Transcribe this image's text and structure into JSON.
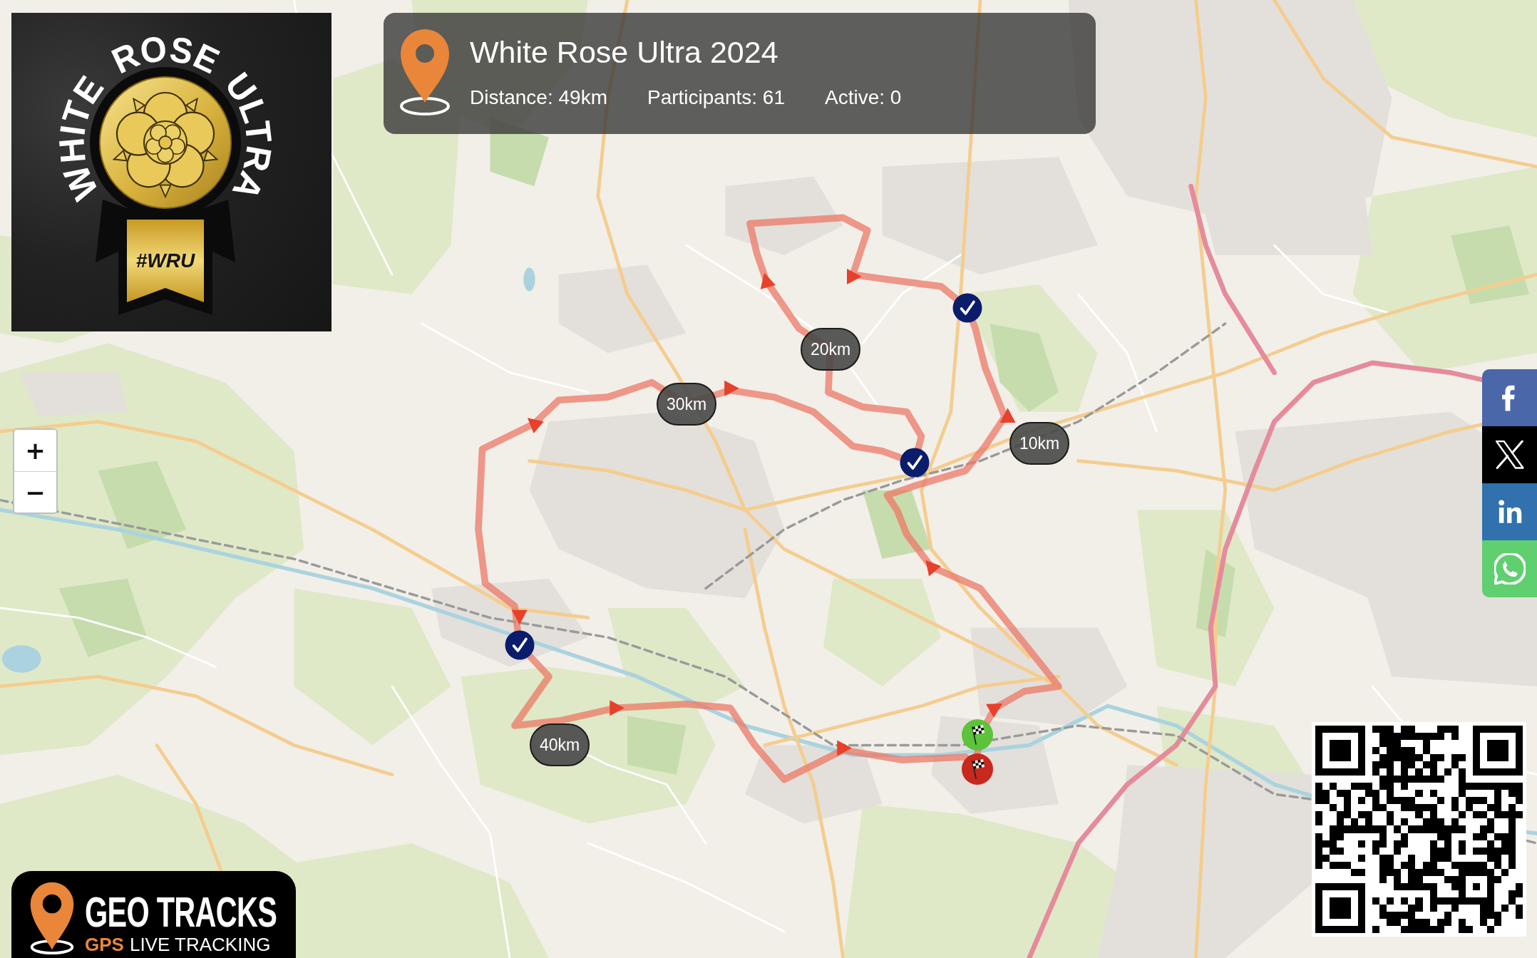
{
  "event_logo": {
    "arc_words": [
      "WHITE",
      "ROSE",
      "ULTRA"
    ],
    "ribbon_text": "#WRU"
  },
  "info_panel": {
    "title": "White Rose Ultra 2024",
    "stats": [
      "Distance: 49km",
      "Participants: 61",
      "Active: 0"
    ]
  },
  "zoom_controls": [
    "+",
    "−"
  ],
  "route_markers": [
    {
      "kind": "distance",
      "label": "10km"
    },
    {
      "kind": "distance",
      "label": "20km"
    },
    {
      "kind": "distance",
      "label": "30km"
    },
    {
      "kind": "distance",
      "label": "40km"
    },
    {
      "kind": "checkpoint"
    },
    {
      "kind": "checkpoint"
    },
    {
      "kind": "checkpoint"
    },
    {
      "kind": "start"
    },
    {
      "kind": "finish"
    }
  ],
  "share_buttons": [
    {
      "kind": "facebook"
    },
    {
      "kind": "x"
    },
    {
      "kind": "linkedin"
    },
    {
      "kind": "whatsapp"
    }
  ],
  "brand": {
    "name": "GEO TRACKS",
    "highlight": "GPS",
    "tagline": "LIVE TRACKING"
  }
}
